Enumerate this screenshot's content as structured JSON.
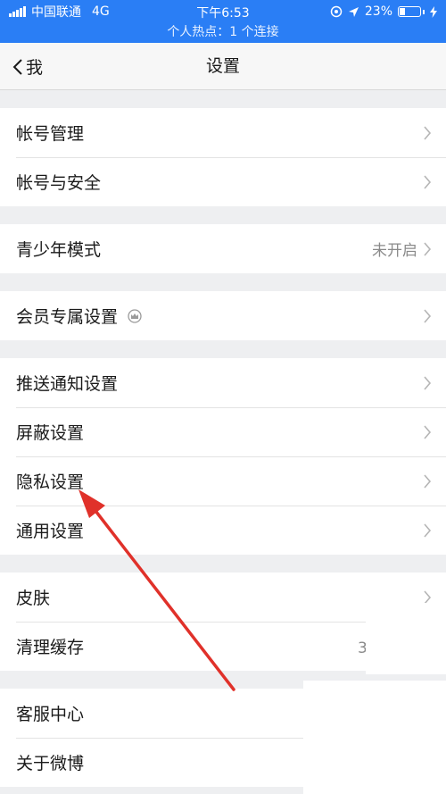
{
  "status_bar": {
    "carrier": "中国联通",
    "network": "4G",
    "time": "下午6:53",
    "battery_percent": "23%",
    "battery_level": 0.23,
    "hotspot_text": "个人热点：1 个连接"
  },
  "nav": {
    "back_label": "我",
    "title": "设置"
  },
  "groups": [
    {
      "rows": [
        {
          "label": "帐号管理",
          "value": ""
        },
        {
          "label": "帐号与安全",
          "value": ""
        }
      ]
    },
    {
      "rows": [
        {
          "label": "青少年模式",
          "value": "未开启"
        }
      ]
    },
    {
      "rows": [
        {
          "label": "会员专属设置",
          "value": "",
          "icon": "crown-icon"
        }
      ]
    },
    {
      "rows": [
        {
          "label": "推送通知设置",
          "value": ""
        },
        {
          "label": "屏蔽设置",
          "value": ""
        },
        {
          "label": "隐私设置",
          "value": ""
        },
        {
          "label": "通用设置",
          "value": ""
        }
      ]
    },
    {
      "rows": [
        {
          "label": "皮肤",
          "value": ""
        },
        {
          "label": "清理缓存",
          "value": ""
        }
      ]
    },
    {
      "rows": [
        {
          "label": "客服中心",
          "value": ""
        },
        {
          "label": "关于微博",
          "value": ""
        }
      ]
    }
  ],
  "cache_value_partial": "3",
  "colors": {
    "status_bar": "#2a7ef5",
    "annotation_arrow": "#e0312a"
  }
}
